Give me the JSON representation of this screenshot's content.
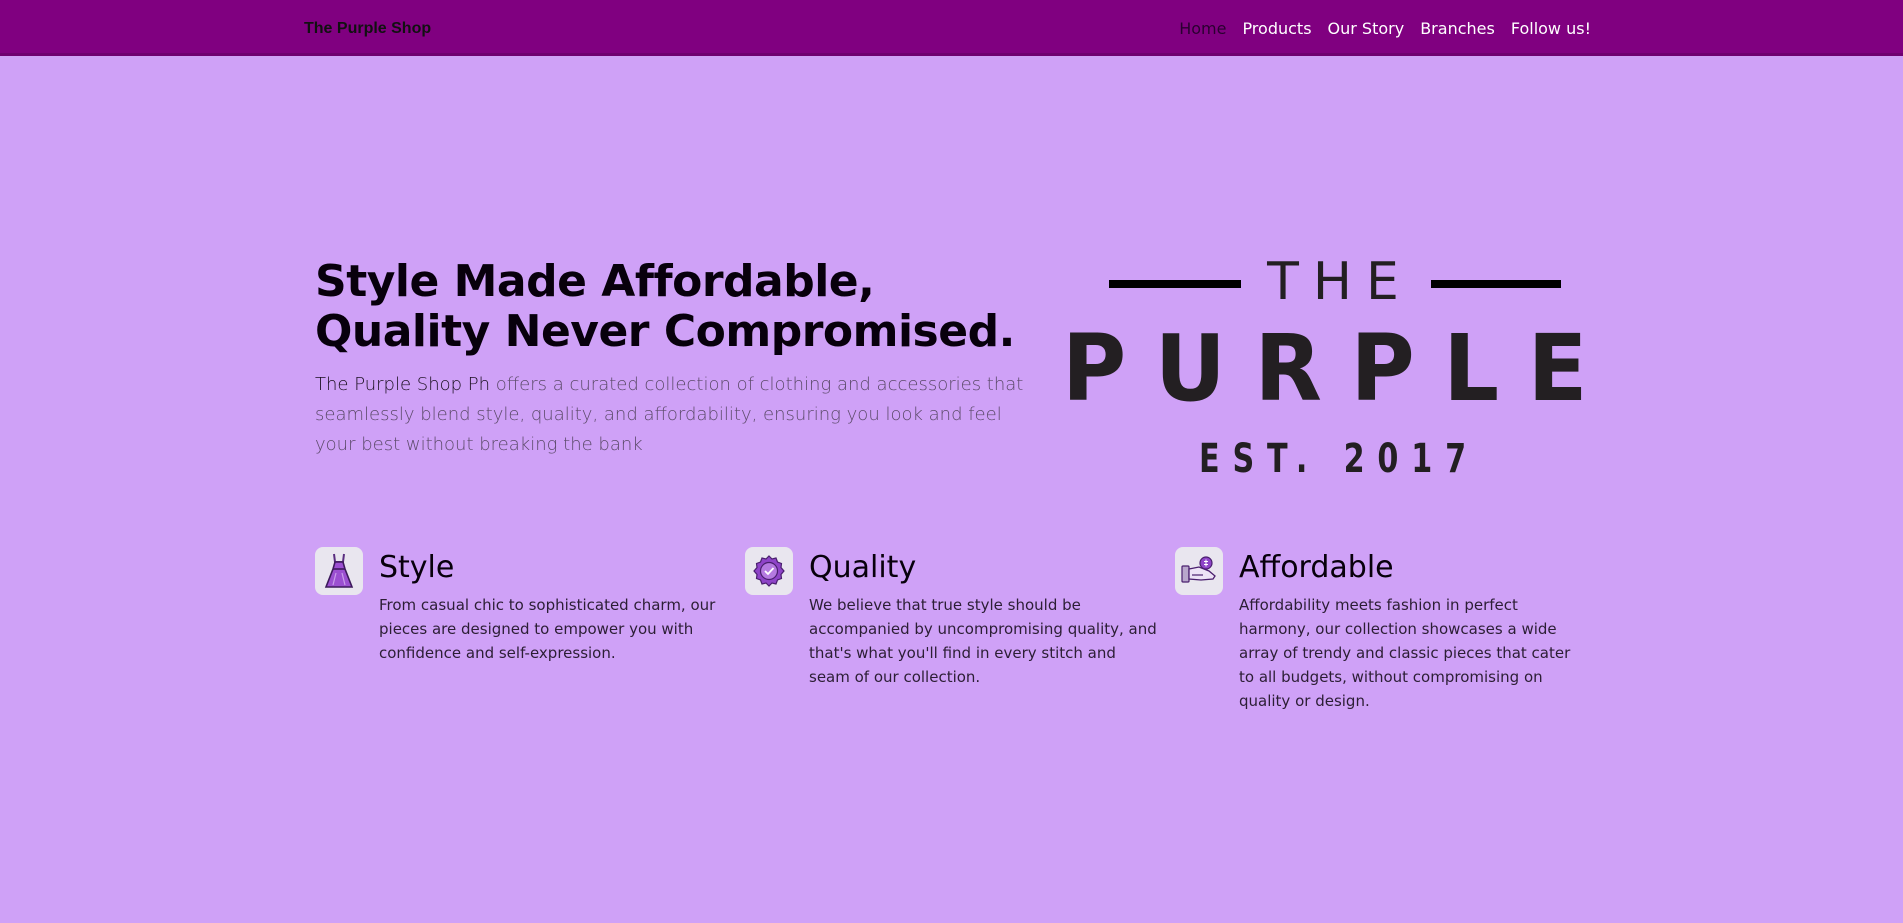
{
  "navbar": {
    "brand": "The Purple Shop",
    "links": [
      "Home",
      "Products",
      "Our Story",
      "Branches",
      "Follow us!"
    ],
    "active_link": "Home",
    "background": "#800080"
  },
  "hero": {
    "title": "Style Made Affordable, Quality Never Compromised.",
    "shop_name": "The Purple Shop Ph",
    "description": " offers a curated collection of clothing and accessories that seamlessly blend style, quality, and affordability, ensuring you look and feel your best without breaking the bank"
  },
  "logo": {
    "line1": "THE",
    "line2": "PURPLE",
    "line3": "EST. 2017"
  },
  "features": [
    {
      "icon": "dress-icon",
      "title": "Style",
      "text": "From casual chic to sophisticated charm, our pieces are designed to empower you with confidence and self-expression."
    },
    {
      "icon": "quality-badge-icon",
      "title": "Quality",
      "text": "We believe that true style should be accompanied by uncompromising quality, and that's what you'll find in every stitch and seam of our collection."
    },
    {
      "icon": "affordable-payment-icon",
      "title": "Affordable",
      "text": "Affordability meets fashion in perfect harmony, our collection showcases a wide array of trendy and classic pieces that cater to all budgets, without compromising on quality or design."
    }
  ],
  "colors": {
    "page_background": "#cfa1f7",
    "accent": "#800080",
    "logo_text": "#231f22"
  }
}
